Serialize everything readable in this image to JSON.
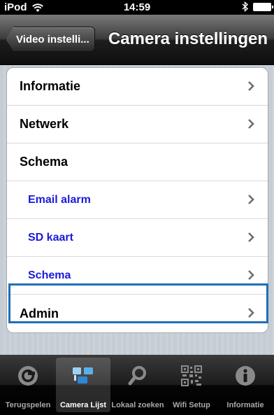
{
  "status_bar": {
    "device": "iPod",
    "time": "14:59"
  },
  "nav": {
    "back_label": "Video instelli...",
    "title": "Camera instellingen"
  },
  "rows": [
    {
      "label": "Informatie",
      "chevron": true
    },
    {
      "label": "Netwerk",
      "chevron": true
    },
    {
      "label": "Schema",
      "chevron": false
    },
    {
      "label": "Email alarm",
      "chevron": true
    },
    {
      "label": "SD kaart",
      "chevron": true
    },
    {
      "label": "Schema",
      "chevron": true
    },
    {
      "label": "Admin",
      "chevron": true
    }
  ],
  "tabs": [
    {
      "label": "Terugspelen",
      "icon": "replay-icon",
      "selected": false
    },
    {
      "label": "Camera Lijst",
      "icon": "camera-list-icon",
      "selected": true
    },
    {
      "label": "Lokaal zoeken",
      "icon": "search-icon",
      "selected": false
    },
    {
      "label": "Wifi Setup",
      "icon": "qr-code-icon",
      "selected": false
    },
    {
      "label": "Informatie",
      "icon": "info-icon",
      "selected": false
    }
  ],
  "colors": {
    "sub_item": "#1a1adb",
    "highlight": "#1f6fb8"
  }
}
